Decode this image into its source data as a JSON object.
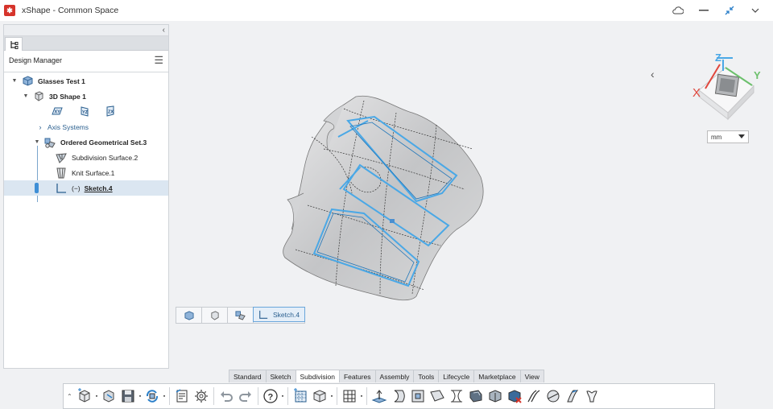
{
  "window": {
    "title": "xShape - Common Space"
  },
  "left_panel": {
    "header": "Design Manager",
    "tree": [
      {
        "label": "Glasses Test 1",
        "bold": true
      },
      {
        "label": "3D Shape 1",
        "bold": true
      },
      {
        "label": "Axis Systems"
      },
      {
        "label": "Ordered Geometrical Set.3",
        "bold": true
      },
      {
        "label": "Subdivision Surface.2"
      },
      {
        "label": "Knit Surface.1"
      },
      {
        "label": "Sketch.4",
        "prefix": "(−)"
      }
    ],
    "axis_buttons": [
      "XY",
      "YZ",
      "ZX"
    ]
  },
  "viewport": {
    "unit": "mm",
    "mini_toolbar_sketch": "Sketch.4",
    "compass_labels": [
      "X",
      "Y",
      "Z"
    ]
  },
  "bottom_tabs": [
    "Standard",
    "Sketch",
    "Subdivision",
    "Features",
    "Assembly",
    "Tools",
    "Lifecycle",
    "Marketplace",
    "View"
  ],
  "active_tab": "Subdivision",
  "colors": {
    "accent": "#4aa8e6",
    "brand": "#d6342b",
    "selection": "#dbe6f1"
  }
}
